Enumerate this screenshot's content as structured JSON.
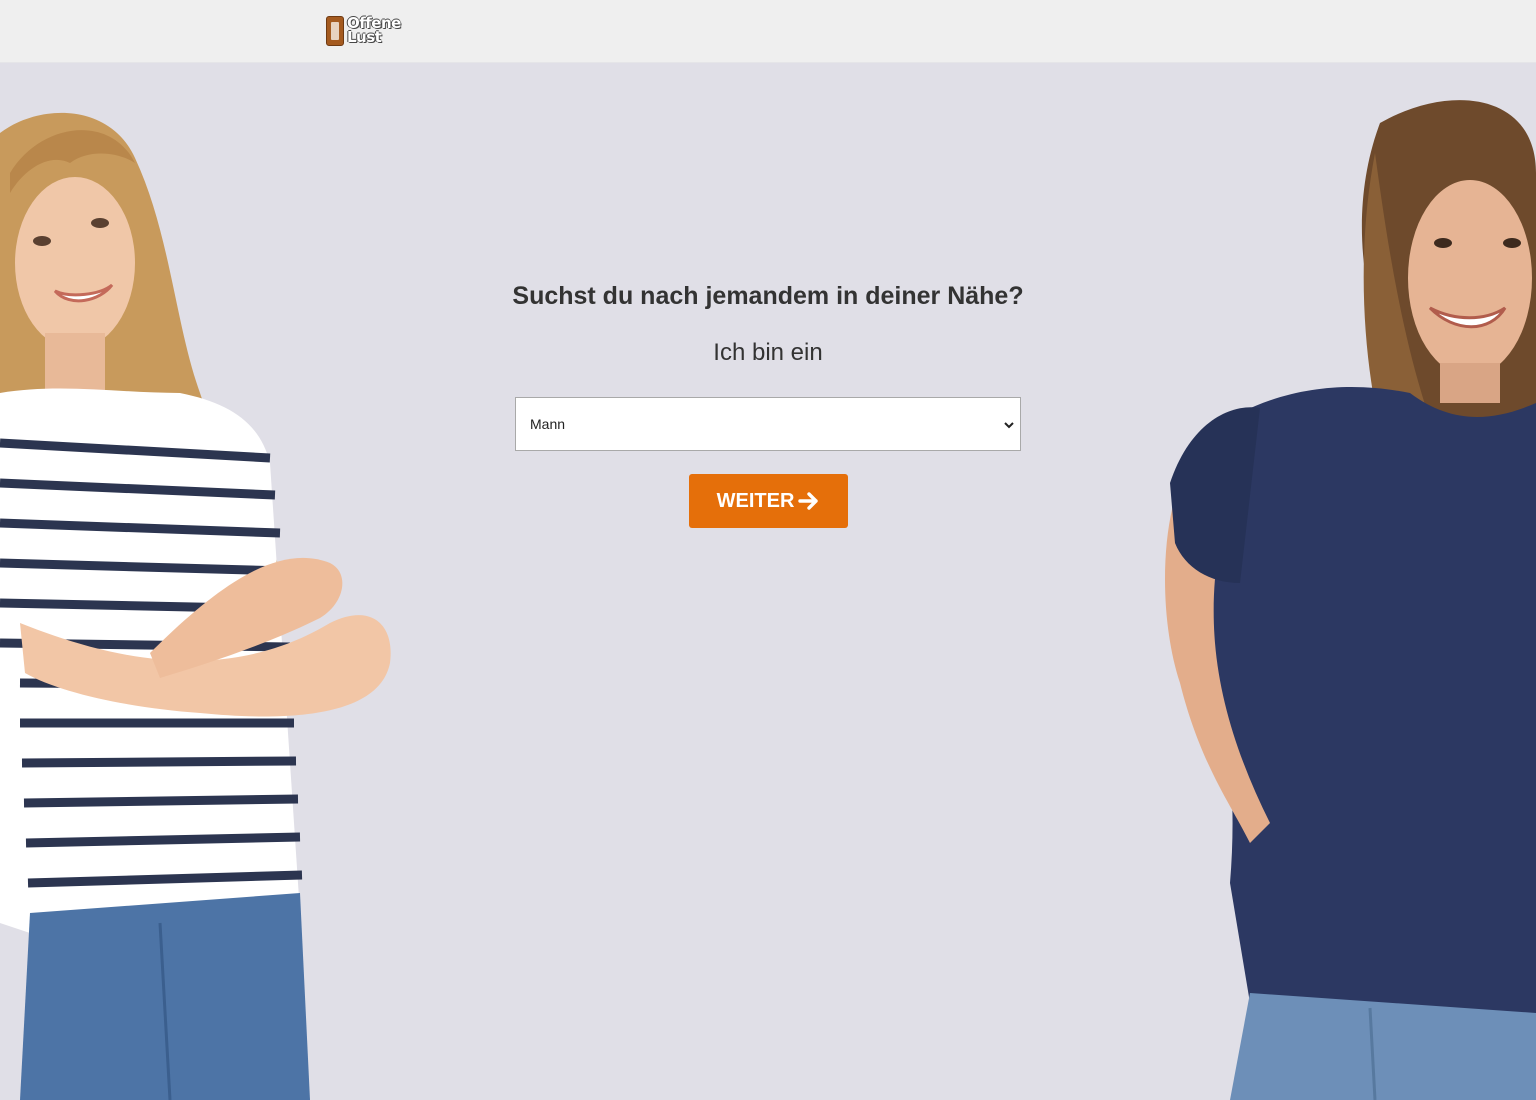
{
  "header": {
    "logo_line1": "Offene",
    "logo_line2": "Lust"
  },
  "main": {
    "headline": "Suchst du nach jemandem in deiner Nähe?",
    "subline": "Ich bin ein",
    "gender_select": {
      "value": "Mann"
    },
    "continue_button": {
      "label": "WEITER"
    }
  },
  "colors": {
    "background": "#e0dfe7",
    "header_background": "#efefef",
    "accent": "#e56f0a",
    "text": "#333333"
  },
  "icons": {
    "button_icon": "arrow-right-icon",
    "select_icon": "chevron-down-icon",
    "logo_icon": "lock-badge-icon"
  }
}
